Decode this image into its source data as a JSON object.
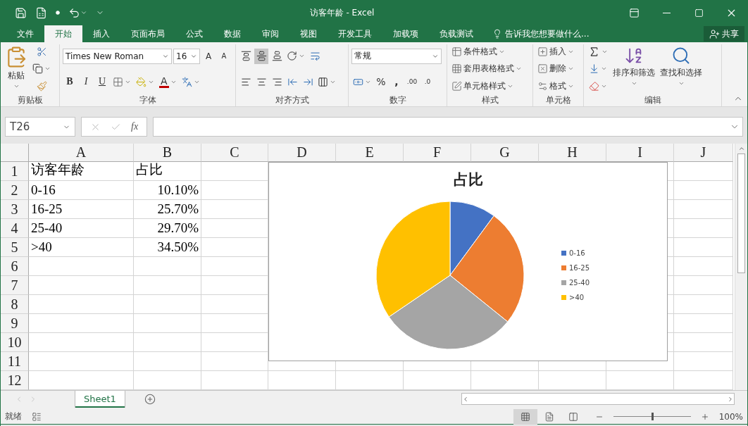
{
  "window": {
    "title": "访客年龄 - Excel"
  },
  "menu_tabs": [
    {
      "label": "文件",
      "selected": false
    },
    {
      "label": "开始",
      "selected": true
    },
    {
      "label": "插入",
      "selected": false
    },
    {
      "label": "页面布局",
      "selected": false
    },
    {
      "label": "公式",
      "selected": false
    },
    {
      "label": "数据",
      "selected": false
    },
    {
      "label": "审阅",
      "selected": false
    },
    {
      "label": "视图",
      "selected": false
    },
    {
      "label": "开发工具",
      "selected": false
    },
    {
      "label": "加载项",
      "selected": false
    },
    {
      "label": "负载测试",
      "selected": false
    }
  ],
  "tell_me": {
    "placeholder": "告诉我您想要做什么..."
  },
  "share_button": "共享",
  "ribbon": {
    "clipboard": {
      "label": "剪贴板",
      "paste": "粘贴"
    },
    "font": {
      "label": "字体",
      "font_name": "Times New Roman",
      "font_size": "16",
      "grow": "A",
      "shrink": "A",
      "bold": "B",
      "italic": "I",
      "underline": "U",
      "font_color": "A"
    },
    "alignment": {
      "label": "对齐方式"
    },
    "number": {
      "label": "数字",
      "format": "常规",
      "percent": "%",
      "comma": ",",
      "decimal_increase": ".00",
      "decimal_decrease": ".0"
    },
    "styles": {
      "label": "样式",
      "buttons": [
        "条件格式",
        "套用表格格式",
        "单元格样式"
      ]
    },
    "cells": {
      "label": "单元格",
      "buttons": [
        "插入",
        "删除",
        "格式"
      ]
    },
    "editing": {
      "label": "编辑",
      "buttons": [
        "排序和筛选",
        "查找和选择"
      ]
    }
  },
  "formula_bar": {
    "name_box": "T26",
    "fx": "fx"
  },
  "sheet": {
    "columns": [
      "A",
      "B",
      "C",
      "D",
      "E",
      "F",
      "G",
      "H",
      "I",
      "J"
    ],
    "rows": [
      {
        "header": "1",
        "cells": [
          "访客年龄",
          "占比"
        ]
      },
      {
        "header": "2",
        "cells": [
          "0-16",
          "10.10%"
        ]
      },
      {
        "header": "3",
        "cells": [
          "16-25",
          "25.70%"
        ]
      },
      {
        "header": "4",
        "cells": [
          "25-40",
          "29.70%"
        ]
      },
      {
        "header": "5",
        "cells": [
          ">40",
          "34.50%"
        ]
      },
      {
        "header": "6",
        "cells": []
      },
      {
        "header": "7",
        "cells": []
      },
      {
        "header": "8",
        "cells": []
      },
      {
        "header": "9",
        "cells": []
      },
      {
        "header": "10",
        "cells": []
      },
      {
        "header": "11",
        "cells": []
      },
      {
        "header": "12",
        "cells": []
      }
    ]
  },
  "chart": {
    "slices": [
      {
        "color": "#4472c4"
      },
      {
        "color": "#ed7d31"
      },
      {
        "color": "#a5a5a5"
      },
      {
        "color": "#ffc000"
      }
    ],
    "chart_data": {
      "type": "pie",
      "title": "占比",
      "categories": [
        "0-16",
        "16-25",
        "25-40",
        ">40"
      ],
      "series": [
        {
          "values": [
            10.1,
            25.7,
            29.7,
            34.5
          ]
        }
      ]
    }
  },
  "sheet_tabs": [
    {
      "label": "Sheet1",
      "selected": true
    }
  ],
  "status_bar": {
    "text": "就绪",
    "views": [
      {
        "selected": true
      },
      {
        "selected": false
      },
      {
        "selected": false
      }
    ],
    "zoom": {
      "level": 0.5
    },
    "zoom_text": "100%"
  }
}
